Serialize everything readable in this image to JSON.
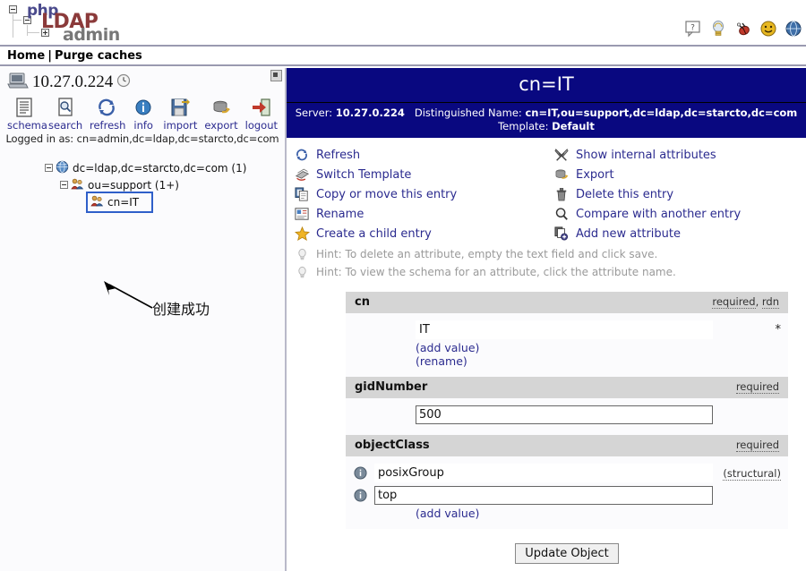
{
  "app": {
    "logo": {
      "php": "php",
      "ldap": "LDAP",
      "admin": "admin"
    }
  },
  "header_icons": [
    {
      "name": "help-icon",
      "title": "Help"
    },
    {
      "name": "lightbulb-icon",
      "title": "Hints"
    },
    {
      "name": "bug-icon",
      "title": "Report a bug"
    },
    {
      "name": "smiley-icon",
      "title": "Donate"
    },
    {
      "name": "globe-icon",
      "title": "Website"
    }
  ],
  "breadcrumb": {
    "home": "Home",
    "separator": "|",
    "purge": "Purge caches"
  },
  "left": {
    "server_name": "10.27.0.224",
    "clock_icon": "clock-icon",
    "tools": [
      {
        "label": "schema",
        "icon": "schema-icon"
      },
      {
        "label": "search",
        "icon": "search-icon"
      },
      {
        "label": "refresh",
        "icon": "refresh-icon"
      },
      {
        "label": "info",
        "icon": "info-icon"
      },
      {
        "label": "import",
        "icon": "import-icon"
      },
      {
        "label": "export",
        "icon": "export-icon"
      },
      {
        "label": "logout",
        "icon": "logout-icon"
      }
    ],
    "logged_in": "Logged in as: cn=admin,dc=ldap,dc=starcto,dc=com",
    "tree": [
      {
        "label": "dc=ldap,dc=starcto,dc=com (1)",
        "level": 1,
        "icon": "globe-icon",
        "expander": "minus",
        "selected": false
      },
      {
        "label": "ou=support (1+)",
        "level": 2,
        "icon": "group-icon",
        "expander": "minus",
        "selected": false
      },
      {
        "label": "cn=IT",
        "level": 3,
        "icon": "group-icon",
        "expander": "none",
        "selected": true
      }
    ],
    "annotation": "创建成功"
  },
  "entry": {
    "title": "cn=IT",
    "server_label": "Server:",
    "server_value": "10.27.0.224",
    "dn_label": "Distinguished Name:",
    "dn_value": "cn=IT,ou=support,dc=ldap,dc=starcto,dc=com",
    "template_label": "Template:",
    "template_value": "Default"
  },
  "actions_left": [
    {
      "label": "Refresh",
      "icon": "refresh-icon"
    },
    {
      "label": "Switch Template",
      "icon": "switch-template-icon"
    },
    {
      "label": "Copy or move this entry",
      "icon": "copy-icon"
    },
    {
      "label": "Rename",
      "icon": "rename-icon"
    },
    {
      "label": "Create a child entry",
      "icon": "star-icon"
    }
  ],
  "actions_right": [
    {
      "label": "Show internal attributes",
      "icon": "tools-icon"
    },
    {
      "label": "Export",
      "icon": "export-icon"
    },
    {
      "label": "Delete this entry",
      "icon": "trash-icon"
    },
    {
      "label": "Compare with another entry",
      "icon": "magnifier-icon"
    },
    {
      "label": "Add new attribute",
      "icon": "add-attribute-icon"
    }
  ],
  "hints": [
    {
      "text": "Hint: To delete an attribute, empty the text field and click save.",
      "icon": "lightbulb-icon"
    },
    {
      "text": "Hint: To view the schema for an attribute, click the attribute name.",
      "icon": "lightbulb-icon"
    }
  ],
  "attributes": [
    {
      "name": "cn",
      "flags": [
        "required",
        "rdn"
      ],
      "values": [
        {
          "value": "IT",
          "editable": false,
          "trailing": "*",
          "icon": null
        }
      ],
      "links": [
        "(add value)",
        "(rename)"
      ]
    },
    {
      "name": "gidNumber",
      "flags": [
        "required"
      ],
      "values": [
        {
          "value": "500",
          "editable": true,
          "trailing": "",
          "icon": null
        }
      ],
      "links": []
    },
    {
      "name": "objectClass",
      "flags": [
        "required"
      ],
      "values": [
        {
          "value": "posixGroup",
          "editable": false,
          "trailing": "(structural)",
          "icon": "info-icon"
        },
        {
          "value": "top",
          "editable": true,
          "trailing": "",
          "icon": "info-icon"
        }
      ],
      "links": [
        "(add value)"
      ]
    }
  ],
  "update_button": "Update Object",
  "colors": {
    "header_blue": "#090880",
    "link_blue": "#2b2b8f",
    "attr_bar_gray": "#d5d5d5",
    "selection_border": "#2f5fc9",
    "hint_gray": "#9a9a9a"
  }
}
